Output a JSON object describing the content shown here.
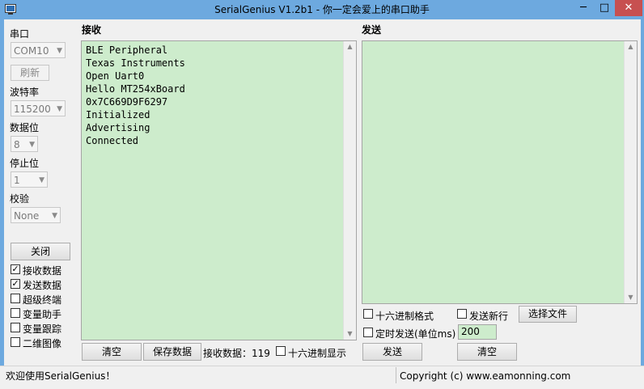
{
  "window": {
    "title": "SerialGenius V1.2b1 - 你一定会爱上的串口助手",
    "min_glyph": "─",
    "max_glyph": "□",
    "close_glyph": "✕"
  },
  "settings": {
    "port_label": "串口",
    "port_value": "COM10",
    "refresh_label": "刷新",
    "baud_label": "波特率",
    "baud_value": "115200",
    "databits_label": "数据位",
    "databits_value": "8",
    "stopbits_label": "停止位",
    "stopbits_value": "1",
    "parity_label": "校验",
    "parity_value": "None",
    "close_button": "关闭"
  },
  "options": [
    {
      "label": "接收数据",
      "checked": true
    },
    {
      "label": "发送数据",
      "checked": true
    },
    {
      "label": "超级终端",
      "checked": false
    },
    {
      "label": "变量助手",
      "checked": false
    },
    {
      "label": "变量跟踪",
      "checked": false
    },
    {
      "label": "二维图像",
      "checked": false
    }
  ],
  "receive": {
    "title": "接收",
    "lines": [
      "BLE Peripheral",
      "Texas Instruments",
      "Open Uart0",
      "Hello MT254xBoard",
      "0x7C669D9F6297",
      "Initialized",
      "Advertising",
      "Connected"
    ],
    "clear_button": "清空",
    "save_button": "保存数据",
    "count_label": "接收数据：",
    "count_value": "119",
    "hex_display_label": "十六进制显示",
    "hex_display_checked": false
  },
  "send": {
    "title": "发送",
    "hex_format_label": "十六进制格式",
    "hex_format_checked": false,
    "newline_label": "发送新行",
    "newline_checked": false,
    "choose_file_button": "选择文件",
    "timer_label": "定时发送(单位ms)",
    "timer_checked": false,
    "timer_value": "200",
    "send_button": "发送",
    "clear_button": "清空"
  },
  "status": {
    "left_text": "欢迎使用SerialGenius！",
    "right_text": "Copyright (c) www.eamonning.com"
  },
  "colors": {
    "titlebar": "#6da9df",
    "textarea_bg": "#cdeccc",
    "close_button": "#c75050"
  },
  "icons": {
    "app": "app-icon",
    "dropdown": "chevron-down-icon",
    "scroll_up": "scroll-up-icon",
    "scroll_down": "scroll-down-icon"
  }
}
